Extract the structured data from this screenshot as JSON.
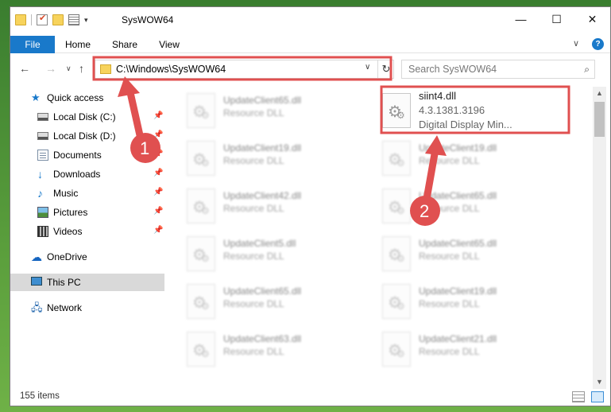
{
  "window": {
    "title": "SysWOW64",
    "min_glyph": "—",
    "max_glyph": "☐",
    "close_glyph": "✕"
  },
  "ribbon": {
    "tabs": [
      {
        "label": "File"
      },
      {
        "label": "Home"
      },
      {
        "label": "Share"
      },
      {
        "label": "View"
      }
    ],
    "expand_glyph": "∨",
    "help_glyph": "?"
  },
  "address_bar": {
    "path": "C:\\Windows\\SysWOW64",
    "dropdown_glyph": "∨",
    "refresh_glyph": "↻"
  },
  "search": {
    "placeholder": "Search SysWOW64",
    "icon_glyph": "⌕"
  },
  "nav": {
    "back_glyph": "←",
    "forward_glyph": "→",
    "recent_glyph": "∨",
    "up_glyph": "↑"
  },
  "sidebar": {
    "items": [
      {
        "label": "Quick access",
        "icon": "star-icon"
      },
      {
        "label": "Local Disk (C:)",
        "icon": "drive-icon",
        "pinned": true
      },
      {
        "label": "Local Disk (D:)",
        "icon": "drive-icon",
        "pinned": true
      },
      {
        "label": "Documents",
        "icon": "documents-icon",
        "pinned": true
      },
      {
        "label": "Downloads",
        "icon": "download-icon",
        "pinned": true
      },
      {
        "label": "Music",
        "icon": "music-icon",
        "pinned": true
      },
      {
        "label": "Pictures",
        "icon": "pictures-icon",
        "pinned": true
      },
      {
        "label": "Videos",
        "icon": "videos-icon",
        "pinned": true
      },
      {
        "label": "OneDrive",
        "icon": "cloud-icon"
      },
      {
        "label": "This PC",
        "icon": "computer-icon",
        "selected": true
      },
      {
        "label": "Network",
        "icon": "network-icon"
      }
    ],
    "pin_glyph": "📌"
  },
  "files": {
    "selected": {
      "name": "siint4.dll",
      "version": "4.3.1381.3196",
      "description": "Digital Display Min..."
    },
    "blurred": [
      {
        "name": "UpdateClient65.dll",
        "desc": "Resource DLL"
      },
      {
        "name": "UpdateClient19.dll",
        "desc": "Resource DLL"
      },
      {
        "name": "UpdateClient19.dll",
        "desc": "Resource DLL"
      },
      {
        "name": "UpdateClient42.dll",
        "desc": "Resource DLL"
      },
      {
        "name": "UpdateClient65.dll",
        "desc": "Resource DLL"
      },
      {
        "name": "UpdateClient5.dll",
        "desc": "Resource DLL"
      },
      {
        "name": "UpdateClient65.dll",
        "desc": "Resource DLL"
      },
      {
        "name": "UpdateClient65.dll",
        "desc": "Resource DLL"
      },
      {
        "name": "UpdateClient19.dll",
        "desc": "Resource DLL"
      },
      {
        "name": "UpdateClient63.dll",
        "desc": "Resource DLL"
      },
      {
        "name": "UpdateClient21.dll",
        "desc": "Resource DLL"
      }
    ]
  },
  "status_bar": {
    "item_count": "155 items"
  },
  "annotations": {
    "step1": "1",
    "step2": "2",
    "color": "#e05050"
  }
}
